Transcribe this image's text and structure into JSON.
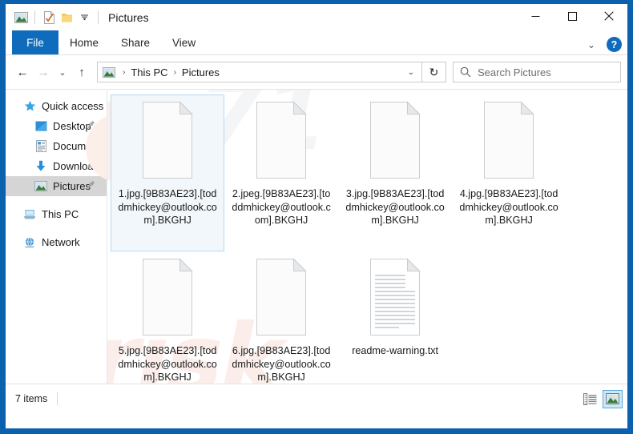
{
  "window": {
    "title": "Pictures",
    "quick_access_icons": [
      "pictures-folder-icon",
      "properties-icon",
      "new-folder-icon",
      "customize-chevron-icon"
    ],
    "controls": {
      "minimize": "—",
      "maximize": "☐",
      "close": "✕"
    },
    "frame_color": "#0c61ae"
  },
  "ribbon": {
    "tabs": [
      {
        "label": "File",
        "active": true
      },
      {
        "label": "Home",
        "active": false
      },
      {
        "label": "Share",
        "active": false
      },
      {
        "label": "View",
        "active": false
      }
    ],
    "collapse_label": "⌄",
    "help_label": "?"
  },
  "navbar": {
    "back": "←",
    "forward": "→",
    "recent": "⌄",
    "up": "↑",
    "breadcrumb": [
      "This PC",
      "Pictures"
    ],
    "breadcrumb_separator": "›",
    "dropdown_chevron": "⌄",
    "refresh": "↻",
    "search_placeholder": "Search Pictures",
    "search_value": ""
  },
  "sidebar": {
    "items": [
      {
        "label": "Quick access",
        "icon": "star-icon",
        "level": "root",
        "pinned": false,
        "selected": false
      },
      {
        "label": "Desktop",
        "icon": "desktop-icon",
        "level": "child",
        "pinned": true,
        "selected": false
      },
      {
        "label": "Documents",
        "icon": "documents-icon",
        "level": "child",
        "pinned": true,
        "selected": false
      },
      {
        "label": "Downloads",
        "icon": "downloads-icon",
        "level": "child",
        "pinned": true,
        "selected": false
      },
      {
        "label": "Pictures",
        "icon": "pictures-icon",
        "level": "child",
        "pinned": true,
        "selected": true
      },
      {
        "label": "This PC",
        "icon": "this-pc-icon",
        "level": "root",
        "pinned": false,
        "selected": false
      },
      {
        "label": "Network",
        "icon": "network-icon",
        "level": "root",
        "pinned": false,
        "selected": false
      }
    ]
  },
  "files": [
    {
      "name": "1.jpg.[9B83AE23].[toddmhickey@outlook.com].BKGHJ",
      "icon": "blank-file-icon",
      "selected": true
    },
    {
      "name": "2.jpeg.[9B83AE23].[toddmhickey@outlook.com].BKGHJ",
      "icon": "blank-file-icon",
      "selected": false
    },
    {
      "name": "3.jpg.[9B83AE23].[toddmhickey@outlook.com].BKGHJ",
      "icon": "blank-file-icon",
      "selected": false
    },
    {
      "name": "4.jpg.[9B83AE23].[toddmhickey@outlook.com].BKGHJ",
      "icon": "blank-file-icon",
      "selected": false
    },
    {
      "name": "5.jpg.[9B83AE23].[toddmhickey@outlook.com].BKGHJ",
      "icon": "blank-file-icon",
      "selected": false
    },
    {
      "name": "6.jpg.[9B83AE23].[toddmhickey@outlook.com].BKGHJ",
      "icon": "blank-file-icon",
      "selected": false
    },
    {
      "name": "readme-warning.txt",
      "icon": "text-file-icon",
      "selected": false
    }
  ],
  "watermark": {
    "text1": "risk",
    "text2": "71"
  },
  "statusbar": {
    "item_count": "7 items",
    "views": [
      {
        "name": "details-view-button",
        "active": false
      },
      {
        "name": "large-icons-view-button",
        "active": true
      }
    ]
  }
}
